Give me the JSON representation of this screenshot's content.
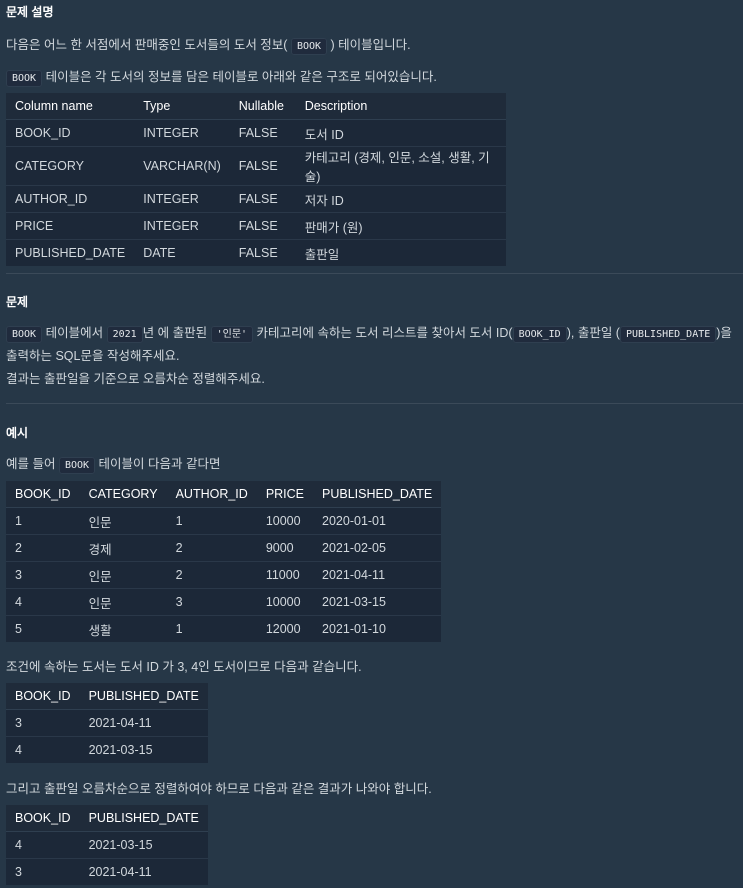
{
  "desc": {
    "heading": "문제 설명",
    "line1_a": "다음은 어느 한 서점에서 판매중인 도서들의 도서 정보(",
    "line1_code": "BOOK",
    "line1_b": ") 테이블입니다.",
    "line2_code": "BOOK",
    "line2_b": "테이블은 각 도서의 정보를 담은 테이블로 아래와 같은 구조로 되어있습니다.",
    "schema": {
      "headers": [
        "Column name",
        "Type",
        "Nullable",
        "Description"
      ],
      "rows": [
        [
          "BOOK_ID",
          "INTEGER",
          "FALSE",
          "도서 ID"
        ],
        [
          "CATEGORY",
          "VARCHAR(N)",
          "FALSE",
          "카테고리 (경제, 인문, 소설, 생활, 기술)"
        ],
        [
          "AUTHOR_ID",
          "INTEGER",
          "FALSE",
          "저자 ID"
        ],
        [
          "PRICE",
          "INTEGER",
          "FALSE",
          "판매가 (원)"
        ],
        [
          "PUBLISHED_DATE",
          "DATE",
          "FALSE",
          "출판일"
        ]
      ]
    }
  },
  "problem": {
    "heading": "문제",
    "c1": "BOOK",
    "t1": "테이블에서",
    "c2": "2021",
    "t2": "년 에 출판된",
    "c3": "'인문'",
    "t3": "카테고리에 속하는 도서 리스트를 찾아서 도서 ID(",
    "c4": "BOOK_ID",
    "t4": "), 출판일 (",
    "c5": "PUBLISHED_DATE",
    "t5": ")을",
    "line2": "출력하는 SQL문을 작성해주세요.",
    "line3": "결과는 출판일을 기준으로 오름차순 정렬해주세요."
  },
  "example": {
    "heading": "예시",
    "intro_a": "예를 들어",
    "intro_code": "BOOK",
    "intro_b": "테이블이 다음과 같다면",
    "table1": {
      "headers": [
        "BOOK_ID",
        "CATEGORY",
        "AUTHOR_ID",
        "PRICE",
        "PUBLISHED_DATE"
      ],
      "rows": [
        [
          "1",
          "인문",
          "1",
          "10000",
          "2020-01-01"
        ],
        [
          "2",
          "경제",
          "2",
          "9000",
          "2021-02-05"
        ],
        [
          "3",
          "인문",
          "2",
          "11000",
          "2021-04-11"
        ],
        [
          "4",
          "인문",
          "3",
          "10000",
          "2021-03-15"
        ],
        [
          "5",
          "생활",
          "1",
          "12000",
          "2021-01-10"
        ]
      ]
    },
    "cond_text": "조건에 속하는 도서는 도서 ID 가 3, 4인 도서이므로 다음과 같습니다.",
    "table2": {
      "headers": [
        "BOOK_ID",
        "PUBLISHED_DATE"
      ],
      "rows": [
        [
          "3",
          "2021-04-11"
        ],
        [
          "4",
          "2021-03-15"
        ]
      ]
    },
    "sort_text": "그리고 출판일 오름차순으로 정렬하여야 하므로 다음과 같은 결과가 나와야 합니다.",
    "table3": {
      "headers": [
        "BOOK_ID",
        "PUBLISHED_DATE"
      ],
      "rows": [
        [
          "4",
          "2021-03-15"
        ],
        [
          "3",
          "2021-04-11"
        ]
      ]
    }
  }
}
